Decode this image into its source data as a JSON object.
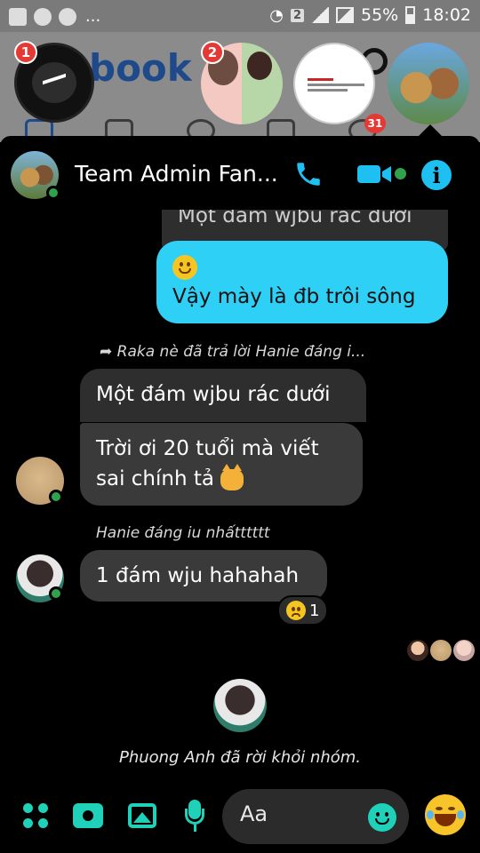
{
  "status_bar": {
    "battery": "55%",
    "time": "18:02",
    "sim_slot": "2",
    "more": "..."
  },
  "background": {
    "facebook_wordmark": "book",
    "notification_badge": "31"
  },
  "chat_heads": [
    {
      "name": "messenger-chat-head",
      "badge": "1"
    },
    {
      "name": "group-photo-chat-head",
      "badge": "2"
    },
    {
      "name": "white-chat-head",
      "badge": ""
    },
    {
      "name": "cats-chat-head",
      "badge": ""
    }
  ],
  "conversation": {
    "title": "Team Admin Fan...",
    "online": true
  },
  "messages": {
    "outgoing_quoted": "Một đám wjbu rác dưới",
    "outgoing_text": "Vậy mày là đb trôi sông",
    "reply_meta": "Raka nè đã trả lời Hanie đáng i...",
    "incoming_quoted": "Một đám wjbu rác dưới",
    "incoming_text": "Trời ơi 20 tuổi mà viết sai chính tả",
    "sender2_name": "Hanie đáng iu nhấtttttt",
    "sender2_text": "1 đám wju hahahah",
    "reaction_count": "1",
    "system_message": "Phuong Anh đã rời khỏi nhóm."
  },
  "composer": {
    "placeholder": "Aa"
  },
  "colors": {
    "accent": "#1fd1b9",
    "outgoing_bubble": "#2fd0f5",
    "incoming_bubble": "#3a3a3a",
    "online": "#31a24c",
    "badge": "#e53935"
  }
}
